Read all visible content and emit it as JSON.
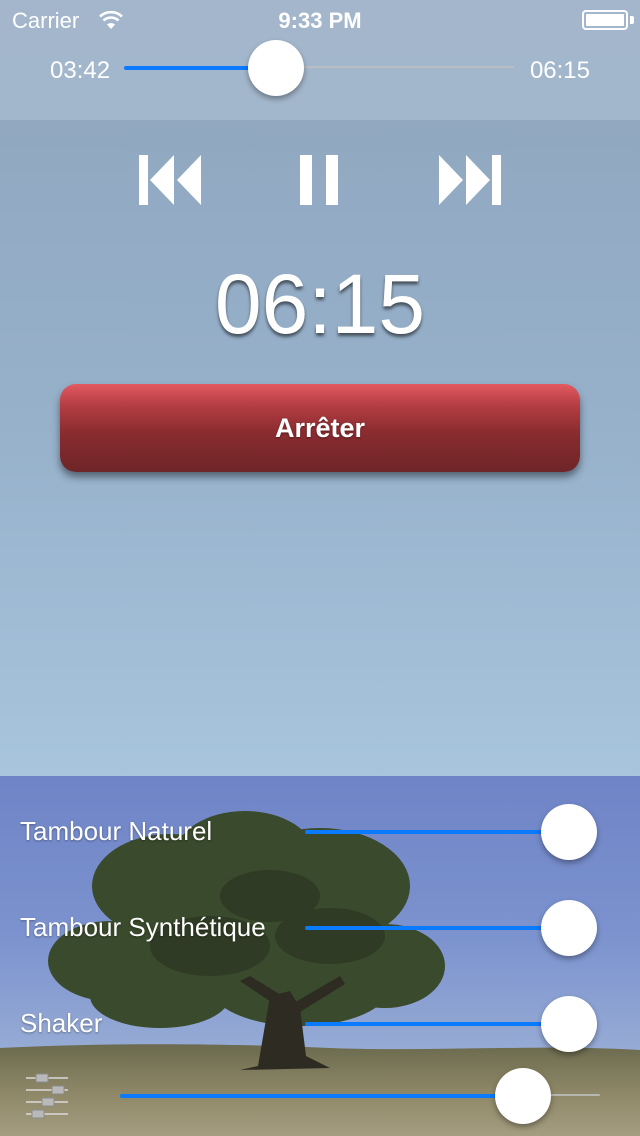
{
  "status_bar": {
    "carrier": "Carrier",
    "time": "9:33 PM",
    "battery_level": 1.0
  },
  "scrubber": {
    "elapsed": "03:42",
    "total": "06:15",
    "progress": 0.39
  },
  "controls": {
    "previous_icon": "skip-previous-icon",
    "pause_icon": "pause-icon",
    "next_icon": "skip-next-icon"
  },
  "timer": {
    "display": "06:15"
  },
  "stop_button": {
    "label": "Arrêter",
    "color": "#a8373c"
  },
  "mixer": {
    "tracks": [
      {
        "name": "Tambour Naturel",
        "level": 1.0
      },
      {
        "name": "Tambour Synthétique",
        "level": 1.0
      },
      {
        "name": "Shaker",
        "level": 1.0
      }
    ],
    "master_icon": "equalizer-icon",
    "master_level": 0.84
  },
  "colors": {
    "accent": "#0a7aff",
    "background_top": "#8ea4bc",
    "background_bottom": "#b5d2e7"
  }
}
